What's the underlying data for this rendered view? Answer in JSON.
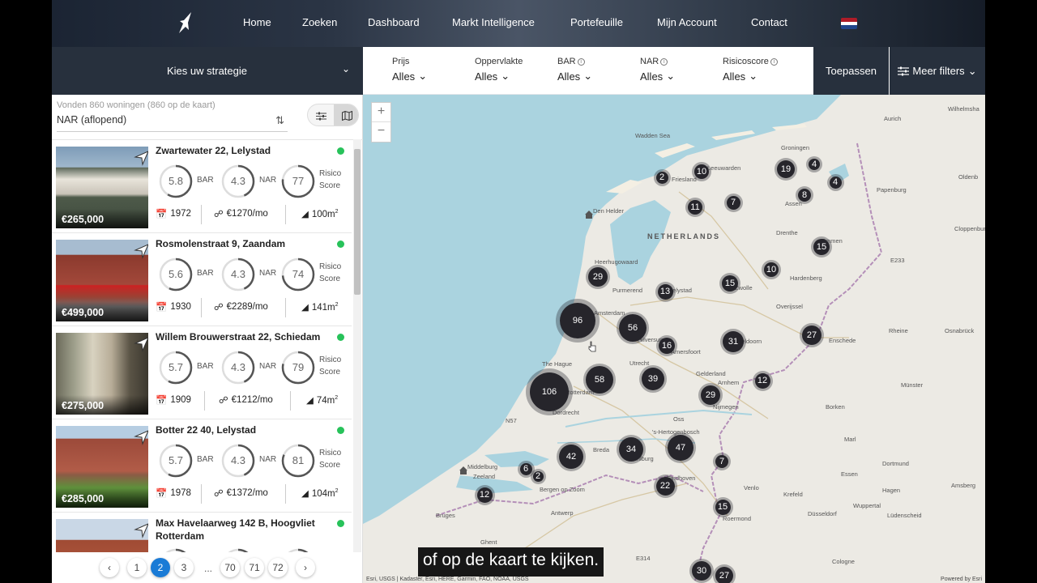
{
  "nav": {
    "links": [
      "Home",
      "Zoeken",
      "Dashboard",
      "Markt Intelligence",
      "Portefeuille",
      "Mijn Account",
      "Contact"
    ],
    "language_flag": "netherlands-flag"
  },
  "filters": {
    "strategy_label": "Kies uw strategie",
    "items": [
      {
        "title": "Prijs",
        "value": "Alles",
        "info": false
      },
      {
        "title": "Oppervlakte",
        "value": "Alles",
        "info": false
      },
      {
        "title": "BAR",
        "value": "Alles",
        "info": true
      },
      {
        "title": "NAR",
        "value": "Alles",
        "info": true
      },
      {
        "title": "Risicoscore",
        "value": "Alles",
        "info": true
      }
    ],
    "apply_label": "Toepassen",
    "more_label": "Meer filters"
  },
  "results": {
    "found_text": "Vonden 860 woningen (860 op de kaart)",
    "sort_value": "NAR (aflopend)"
  },
  "gauge_labels": {
    "bar": "BAR",
    "nar": "NAR",
    "risk_1": "Risico",
    "risk_2": "Score"
  },
  "listings": [
    {
      "address": "Zwartewater 22, Lelystad",
      "price": "€265,000",
      "bar": "5.8",
      "nar": "4.3",
      "risk": "77",
      "year": "1972",
      "rent": "€1270/mo",
      "area": "100m",
      "status_color": "#27c25a"
    },
    {
      "address": "Rosmolenstraat 9, Zaandam",
      "price": "€499,000",
      "bar": "5.6",
      "nar": "4.3",
      "risk": "74",
      "year": "1930",
      "rent": "€2289/mo",
      "area": "141m",
      "status_color": "#27c25a"
    },
    {
      "address": "Willem Brouwerstraat 22, Schiedam",
      "price": "€275,000",
      "bar": "5.7",
      "nar": "4.3",
      "risk": "79",
      "year": "1909",
      "rent": "€1212/mo",
      "area": "74m",
      "status_color": "#27c25a"
    },
    {
      "address": "Botter 22 40, Lelystad",
      "price": "€285,000",
      "bar": "5.7",
      "nar": "4.3",
      "risk": "81",
      "year": "1978",
      "rent": "€1372/mo",
      "area": "104m",
      "status_color": "#27c25a"
    },
    {
      "address": "Max Havelaarweg 142 B, Hoogvliet Rotterdam",
      "price": "",
      "bar": "",
      "nar": "",
      "risk": "",
      "year": "",
      "rent": "",
      "area": "",
      "status_color": "#27c25a"
    }
  ],
  "pagination": {
    "pages": [
      "1",
      "2",
      "3",
      "...",
      "70",
      "71",
      "72"
    ],
    "current": "2"
  },
  "map": {
    "country_label": "NETHERLANDS",
    "clusters": [
      "2",
      "10",
      "19",
      "4",
      "4",
      "11",
      "7",
      "8",
      "15",
      "29",
      "13",
      "15",
      "10",
      "96",
      "56",
      "16",
      "31",
      "27",
      "106",
      "58",
      "39",
      "12",
      "29",
      "42",
      "34",
      "47",
      "6",
      "2",
      "7",
      "22",
      "12",
      "15",
      "30",
      "27"
    ],
    "place_labels": [
      "Wilhelmsha",
      "Aurich",
      "Groningen",
      "Friesland",
      "Leeuwarden",
      "Oldenb",
      "Papenburg",
      "Wadden Sea",
      "Den Helder",
      "Assen",
      "Drenthe",
      "Cloppenburg",
      "Heerhugowaard",
      "Emmen",
      "E233",
      "Purmerend",
      "Lelystad",
      "Hardenberg",
      "Zwolle",
      "Overijssel",
      "Amsterdam",
      "Hilversum",
      "Amersfoort",
      "Rheine",
      "Osnabrück",
      "Enschede",
      "The Hague",
      "Utrecht",
      "Gelderland",
      "Apeldoorn",
      "Arnhem",
      "Rotterdam",
      "Münster",
      "Nijmegen",
      "Borken",
      "Dordrecht",
      "Oss",
      "N57",
      "'s-Hertogenbosch",
      "Breda",
      "Marl",
      "Middelburg",
      "Zeeland",
      "Bergen op Zoom",
      "Tilburg",
      "Eindhoven",
      "Dortmund",
      "Essen",
      "Venlo",
      "Krefeld",
      "Hagen",
      "Bruges",
      "Antwerp",
      "Wuppertal",
      "Amsberg",
      "Düsseldorf",
      "Roermond",
      "Lüdenscheid",
      "Ghent",
      "E314",
      "Cologne"
    ],
    "attribution": "Esri, USGS | Kadaster, Esri, HERE, Garmin, FAO, NOAA, USGS",
    "powered_by": "Powered by Esri"
  },
  "subtitle": "of op de kaart te kijken."
}
